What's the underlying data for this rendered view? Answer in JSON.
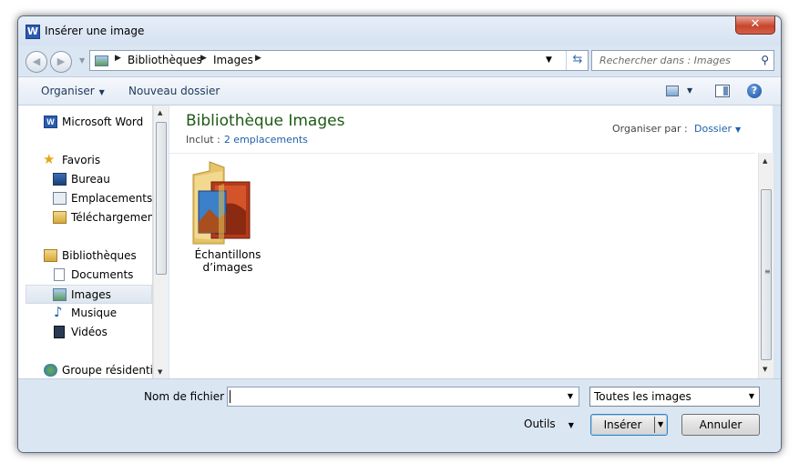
{
  "window": {
    "title": "Insérer une image",
    "app_icon": "word-icon",
    "close_label": "✕"
  },
  "address": {
    "crumbs": [
      "Bibliothèques",
      "Images"
    ]
  },
  "search": {
    "placeholder": "Rechercher dans : Images"
  },
  "toolbar": {
    "organize": "Organiser",
    "new_folder": "Nouveau dossier"
  },
  "nav": {
    "items": [
      {
        "label": "Microsoft Word",
        "icon": "word-icon"
      },
      {
        "label": "Favoris",
        "icon": "star-icon"
      },
      {
        "label": "Bureau",
        "icon": "desktop-icon"
      },
      {
        "label": "Emplacements ré",
        "icon": "recent-places-icon"
      },
      {
        "label": "Téléchargements",
        "icon": "downloads-icon"
      },
      {
        "label": "Bibliothèques",
        "icon": "libraries-icon"
      },
      {
        "label": "Documents",
        "icon": "documents-icon"
      },
      {
        "label": "Images",
        "icon": "pictures-icon",
        "selected": true
      },
      {
        "label": "Musique",
        "icon": "music-icon"
      },
      {
        "label": "Vidéos",
        "icon": "videos-icon"
      },
      {
        "label": "Groupe résidentiel",
        "icon": "homegroup-icon"
      }
    ]
  },
  "library": {
    "title": "Bibliothèque Images",
    "includes_label": "Inclut :",
    "includes_link": "2 emplacements",
    "arrange_label": "Organiser par :",
    "arrange_value": "Dossier"
  },
  "files": [
    {
      "name_line1": "Échantillons",
      "name_line2": "d’images",
      "icon": "sample-pictures-folder-icon"
    }
  ],
  "bottom": {
    "filename_label": "Nom de fichier :",
    "filename_value": "",
    "filter_value": "Toutes les images",
    "tools": "Outils",
    "insert": "Insérer",
    "cancel": "Annuler"
  }
}
